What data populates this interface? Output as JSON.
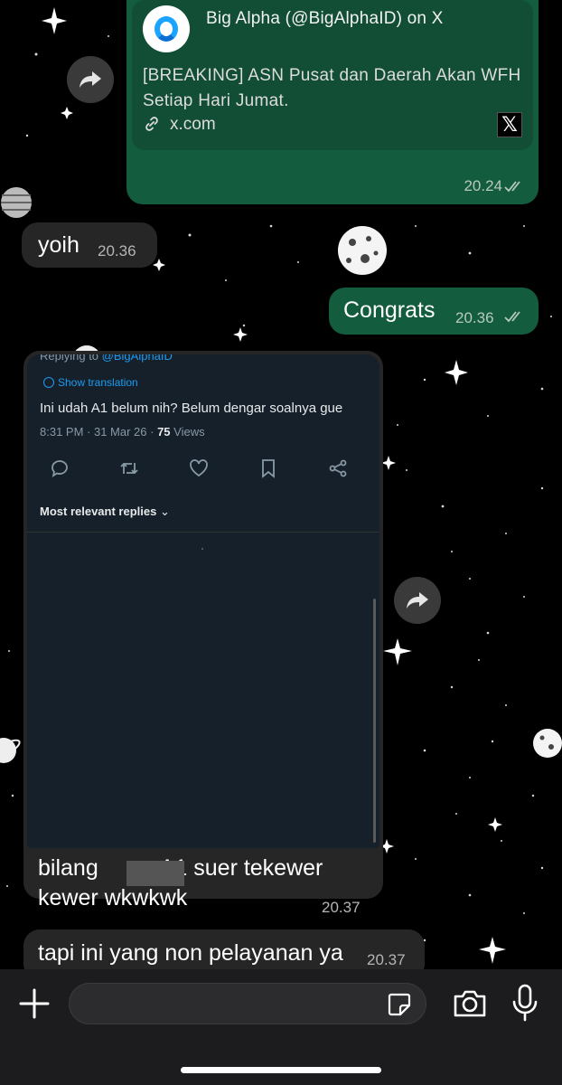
{
  "link_preview": {
    "title": "Big Alpha (@BigAlphaID) on X",
    "description": "[BREAKING] ASN Pusat dan Daerah Akan WFH Setiap Hari Jumat.",
    "domain": "x.com",
    "time": "20.24"
  },
  "messages": [
    {
      "text": "yoih",
      "time": "20.36"
    },
    {
      "text": "Congrats",
      "time": "20.36"
    }
  ],
  "screenshot": {
    "replying_to_prefix": "Replying to",
    "replying_to_handle": "@BigAlphaID",
    "show_translation": "Show translation",
    "tweet_text": "Ini udah A1 belum nih? Belum dengar soalnya gue",
    "meta_time": "8:31 PM · 31 Mar 26 · ",
    "meta_views_count": "75",
    "meta_views_label": " Views",
    "most_relevant": "Most relevant replies"
  },
  "caption": {
    "line1_before": "bilang",
    "line1_after": "A1 suer tekewer",
    "line2": "kewer wkwkwk",
    "time": "20.37"
  },
  "last_message": {
    "text": "tapi ini yang non pelayanan ya",
    "time": "20.37"
  },
  "colors": {
    "incoming_bubble": "#262626",
    "outgoing_bubble": "#135c3e",
    "link_card": "#124d36",
    "twitter_blue": "#1d9bf0",
    "bottom_bar": "#1c1c1e"
  },
  "icons": [
    "forward-icon",
    "link-icon",
    "x-logo-icon",
    "double-check-icon",
    "plus-icon",
    "sticker-icon",
    "camera-icon",
    "microphone-icon"
  ]
}
